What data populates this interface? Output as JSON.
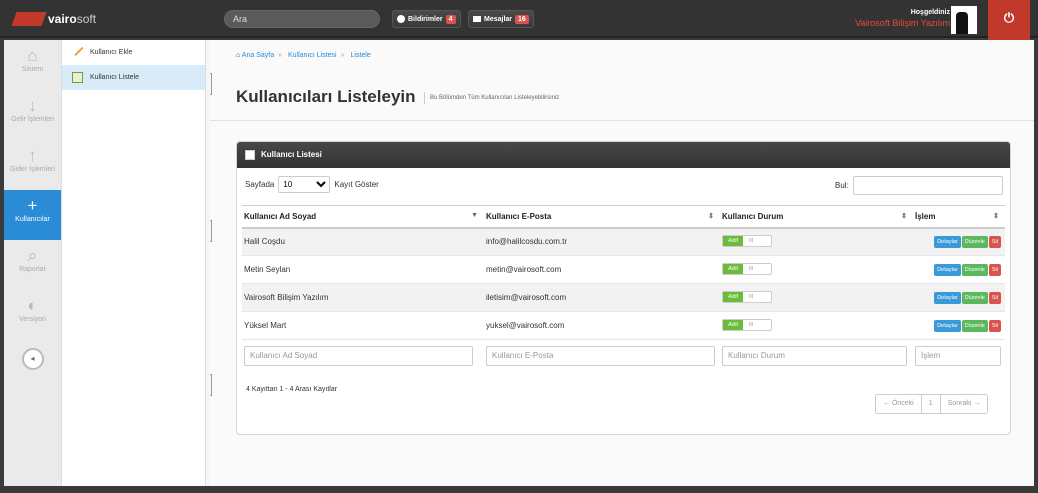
{
  "topbar": {
    "logo_brand": "vairo",
    "logo_rest": "soft",
    "search_value": "Ara",
    "notifications_label": "Bildirimler",
    "notifications_count": "4",
    "messages_label": "Mesajlar",
    "messages_count": "16",
    "welcome": "Hoşgeldiniz",
    "company": "Vairosoft Bilişim Yazılım",
    "power_icon": "power-icon"
  },
  "iconbar": [
    {
      "label": "Sistem",
      "icon": "home-icon",
      "glyph": "⌂"
    },
    {
      "label": "Gelir İşlemleri",
      "icon": "arrow-down-icon",
      "glyph": "↓"
    },
    {
      "label": "Gider İşlemleri",
      "icon": "arrow-up-icon",
      "glyph": "↑"
    },
    {
      "label": "Kullanıcılar",
      "icon": "add-user-icon",
      "glyph": "+"
    },
    {
      "label": "Raporlar",
      "icon": "paperclip-icon",
      "glyph": "⌕"
    },
    {
      "label": "Versiyon",
      "icon": "toggle-icon",
      "glyph": "◐"
    }
  ],
  "submenu": {
    "add_user": "Kullanıcı Ekle",
    "list_users": "Kullanıcı Listele"
  },
  "breadcrumb": [
    "Ana Sayfa",
    "Kullanıcı Listesi",
    "Listele"
  ],
  "page": {
    "title": "Kullanıcıları Listeleyin",
    "subtitle": "Bu Bölümden Tüm Kullanıcıları Listeleyebilirsiniz"
  },
  "panel": {
    "title": "Kullanıcı Listesi",
    "per_page_label": "Sayfada",
    "per_page_value": "10",
    "per_page_suffix": "Kayıt Göster",
    "find_label": "Bul:"
  },
  "table": {
    "columns": [
      "Kullanıcı Ad Soyad",
      "Kullanıcı E-Posta",
      "Kullanıcı Durum",
      "İşlem"
    ],
    "rows": [
      {
        "name": "Halil Coşdu",
        "email": "info@halilcosdu.com.tr",
        "status": "Aktif"
      },
      {
        "name": "Metin Seylan",
        "email": "metin@vairosoft.com",
        "status": "Aktif"
      },
      {
        "name": "Vairosoft Bilişim Yazılım",
        "email": "iletisim@vairosoft.com",
        "status": "Aktif"
      },
      {
        "name": "Yüksel Mart",
        "email": "yuksel@vairosoft.com",
        "status": "Aktif"
      }
    ],
    "toggle_off": "III",
    "actions": {
      "detail": "Detaylar",
      "edit": "Düzenle",
      "delete": "Sil"
    },
    "filters": [
      "Kullanıcı Ad Soyad",
      "Kullanıcı E-Posta",
      "Kullanıcı Durum",
      "İşlem"
    ]
  },
  "footer": {
    "info": "4 Kayıttan 1 - 4 Arası Kayıtlar",
    "prev": "← Önceki",
    "page": "1",
    "next": "Sonraki →"
  }
}
